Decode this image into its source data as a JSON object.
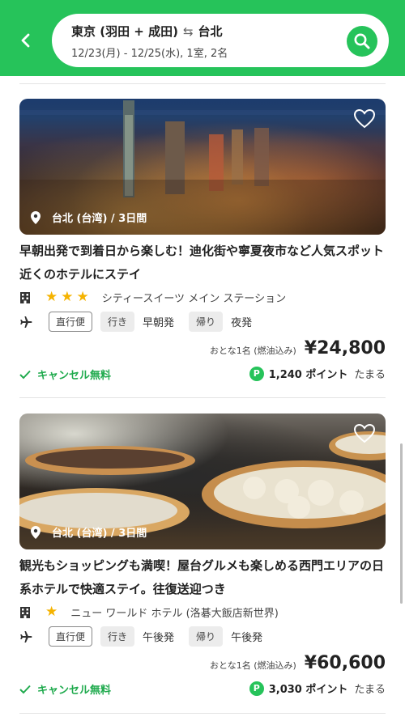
{
  "header": {
    "origin": "東京 (羽田 + 成田)",
    "destination": "台北",
    "details": "12/23(月) - 12/25(水), 1室, 2名"
  },
  "colors": {
    "brand": "#26c35a",
    "star": "#f5b300",
    "cancel": "#1faa4d"
  },
  "cards": [
    {
      "location": "台北 (台湾) / 3日間",
      "title": "早朝出発で到着日から楽しむ！迪化街や寧夏夜市など人気スポット近くのホテルにステイ",
      "stars": 3,
      "hotel": "シティースイーツ メイン ステーション",
      "direct": "直行便",
      "outbound_label": "行き",
      "outbound_time": "早朝発",
      "return_label": "帰り",
      "return_time": "夜発",
      "price_label": "おとな1名 (燃油込み)",
      "price": "¥24,800",
      "cancel": "キャンセル無料",
      "points_badge": "P",
      "points": "1,240 ポイント",
      "points_suffix": "たまる"
    },
    {
      "location": "台北 (台湾) / 3日間",
      "title": "観光もショッピングも満喫！屋台グルメも楽しめる西門エリアの日系ホテルで快適ステイ。往復送迎つき",
      "stars": 1,
      "hotel": "ニュー ワールド ホテル (洛碁大飯店新世界)",
      "direct": "直行便",
      "outbound_label": "行き",
      "outbound_time": "午後発",
      "return_label": "帰り",
      "return_time": "午後発",
      "price_label": "おとな1名 (燃油込み)",
      "price": "¥60,600",
      "cancel": "キャンセル無料",
      "points_badge": "P",
      "points": "3,030 ポイント",
      "points_suffix": "たまる"
    }
  ]
}
